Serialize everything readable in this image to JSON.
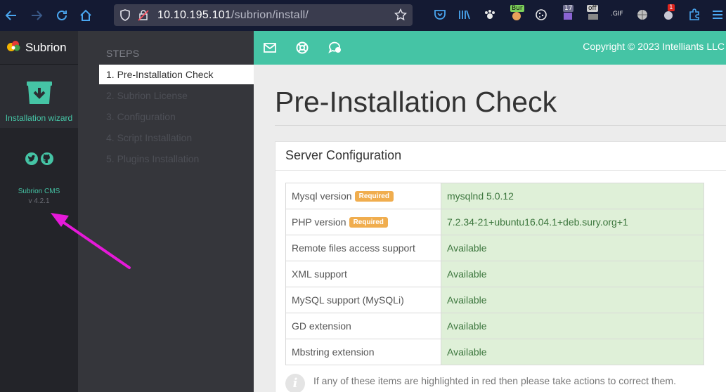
{
  "browser": {
    "url_host": "10.10.195.101",
    "url_path": "/subrion/install/",
    "extensions": [
      {
        "icon": "pocket-icon"
      },
      {
        "icon": "library-icon"
      },
      {
        "icon": "paw-icon"
      },
      {
        "icon": "burp-icon",
        "badge": "Bur"
      },
      {
        "icon": "cookie-icon"
      },
      {
        "icon": "counter-icon",
        "badge": "17"
      },
      {
        "icon": "off-icon",
        "badge": "off"
      },
      {
        "icon": "gif-icon",
        "badge": ".GIF"
      },
      {
        "icon": "globe-icon"
      },
      {
        "icon": "notify-icon",
        "badge": "1"
      },
      {
        "icon": "puzzle-icon"
      },
      {
        "icon": "menu-icon"
      }
    ]
  },
  "sidebar": {
    "brand": "Subrion",
    "wizard_label": "Installation wizard",
    "cms_name": "Subrion CMS",
    "version": "v 4.2.1"
  },
  "steps": {
    "title": "STEPS",
    "items": [
      {
        "label": "1. Pre-Installation Check",
        "active": true
      },
      {
        "label": "2. Subrion License",
        "active": false
      },
      {
        "label": "3. Configuration",
        "active": false
      },
      {
        "label": "4. Script Installation",
        "active": false
      },
      {
        "label": "5. Plugins Installation",
        "active": false
      }
    ]
  },
  "header": {
    "copyright": "Copyright © 2023 Intelliants LLC"
  },
  "main": {
    "title": "Pre-Installation Check",
    "panel_title": "Server Configuration",
    "required_label": "Required",
    "rows": [
      {
        "name": "Mysql version",
        "required": true,
        "value": "mysqlnd 5.0.12"
      },
      {
        "name": "PHP version",
        "required": true,
        "value": "7.2.34-21+ubuntu16.04.1+deb.sury.org+1"
      },
      {
        "name": "Remote files access support",
        "required": false,
        "value": "Available"
      },
      {
        "name": "XML support",
        "required": false,
        "value": "Available"
      },
      {
        "name": "MySQL support (MySQLi)",
        "required": false,
        "value": "Available"
      },
      {
        "name": "GD extension",
        "required": false,
        "value": "Available"
      },
      {
        "name": "Mbstring extension",
        "required": false,
        "value": "Available"
      }
    ],
    "note": "If any of these items are highlighted in red then please take actions to correct them. Failure to do so could lead to your installation not functioning correctly."
  },
  "colors": {
    "accent": "#45c4a5",
    "annotation_arrow": "#e619d9",
    "required_badge": "#f0ad4e",
    "success_bg": "#dff0d8"
  }
}
